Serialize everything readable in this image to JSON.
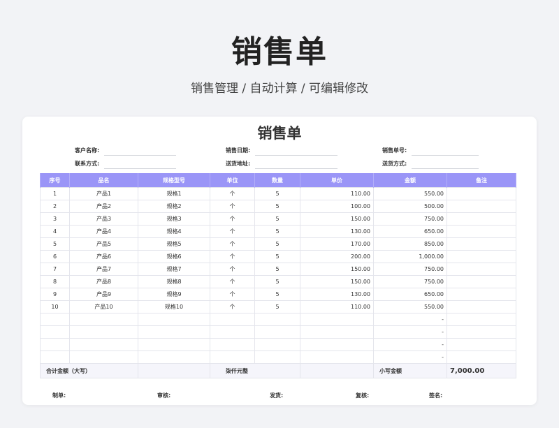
{
  "hero": {
    "title": "销售单",
    "subtitle": "销售管理 / 自动计算 / 可编辑修改"
  },
  "doc": {
    "title": "销售单",
    "fields": {
      "customer_name": "客户名称:",
      "contact": "联系方式:",
      "sale_date": "销售日期:",
      "address": "送货地址:",
      "order_no": "销售单号:",
      "delivery_method": "送货方式:"
    },
    "columns": [
      "序号",
      "品名",
      "规格型号",
      "单位",
      "数量",
      "单价",
      "金额",
      "备注"
    ],
    "rows": [
      {
        "no": "1",
        "name": "产品1",
        "spec": "规格1",
        "unit": "个",
        "qty": "5",
        "price": "110.00",
        "amount": "550.00",
        "note": ""
      },
      {
        "no": "2",
        "name": "产品2",
        "spec": "规格2",
        "unit": "个",
        "qty": "5",
        "price": "100.00",
        "amount": "500.00",
        "note": ""
      },
      {
        "no": "3",
        "name": "产品3",
        "spec": "规格3",
        "unit": "个",
        "qty": "5",
        "price": "150.00",
        "amount": "750.00",
        "note": ""
      },
      {
        "no": "4",
        "name": "产品4",
        "spec": "规格4",
        "unit": "个",
        "qty": "5",
        "price": "130.00",
        "amount": "650.00",
        "note": ""
      },
      {
        "no": "5",
        "name": "产品5",
        "spec": "规格5",
        "unit": "个",
        "qty": "5",
        "price": "170.00",
        "amount": "850.00",
        "note": ""
      },
      {
        "no": "6",
        "name": "产品6",
        "spec": "规格6",
        "unit": "个",
        "qty": "5",
        "price": "200.00",
        "amount": "1,000.00",
        "note": ""
      },
      {
        "no": "7",
        "name": "产品7",
        "spec": "规格7",
        "unit": "个",
        "qty": "5",
        "price": "150.00",
        "amount": "750.00",
        "note": ""
      },
      {
        "no": "8",
        "name": "产品8",
        "spec": "规格8",
        "unit": "个",
        "qty": "5",
        "price": "150.00",
        "amount": "750.00",
        "note": ""
      },
      {
        "no": "9",
        "name": "产品9",
        "spec": "规格9",
        "unit": "个",
        "qty": "5",
        "price": "130.00",
        "amount": "650.00",
        "note": ""
      },
      {
        "no": "10",
        "name": "产品10",
        "spec": "规格10",
        "unit": "个",
        "qty": "5",
        "price": "110.00",
        "amount": "550.00",
        "note": ""
      },
      {
        "no": "",
        "name": "",
        "spec": "",
        "unit": "",
        "qty": "",
        "price": "",
        "amount": "-",
        "note": ""
      },
      {
        "no": "",
        "name": "",
        "spec": "",
        "unit": "",
        "qty": "",
        "price": "",
        "amount": "-",
        "note": ""
      },
      {
        "no": "",
        "name": "",
        "spec": "",
        "unit": "",
        "qty": "",
        "price": "",
        "amount": "-",
        "note": ""
      },
      {
        "no": "",
        "name": "",
        "spec": "",
        "unit": "",
        "qty": "",
        "price": "",
        "amount": "-",
        "note": ""
      }
    ],
    "total": {
      "label_upper": "合计金额（大写）",
      "upper_value": "柒仟元整",
      "label_lower": "小写金额",
      "lower_value": "7,000.00"
    },
    "signatures": {
      "maker": "制单:",
      "review": "审核:",
      "ship": "发货:",
      "recheck": "复核:",
      "sign": "签名:"
    }
  },
  "colors": {
    "header": "#9a95f7",
    "background": "#f2f3f6",
    "card": "#ffffff"
  }
}
